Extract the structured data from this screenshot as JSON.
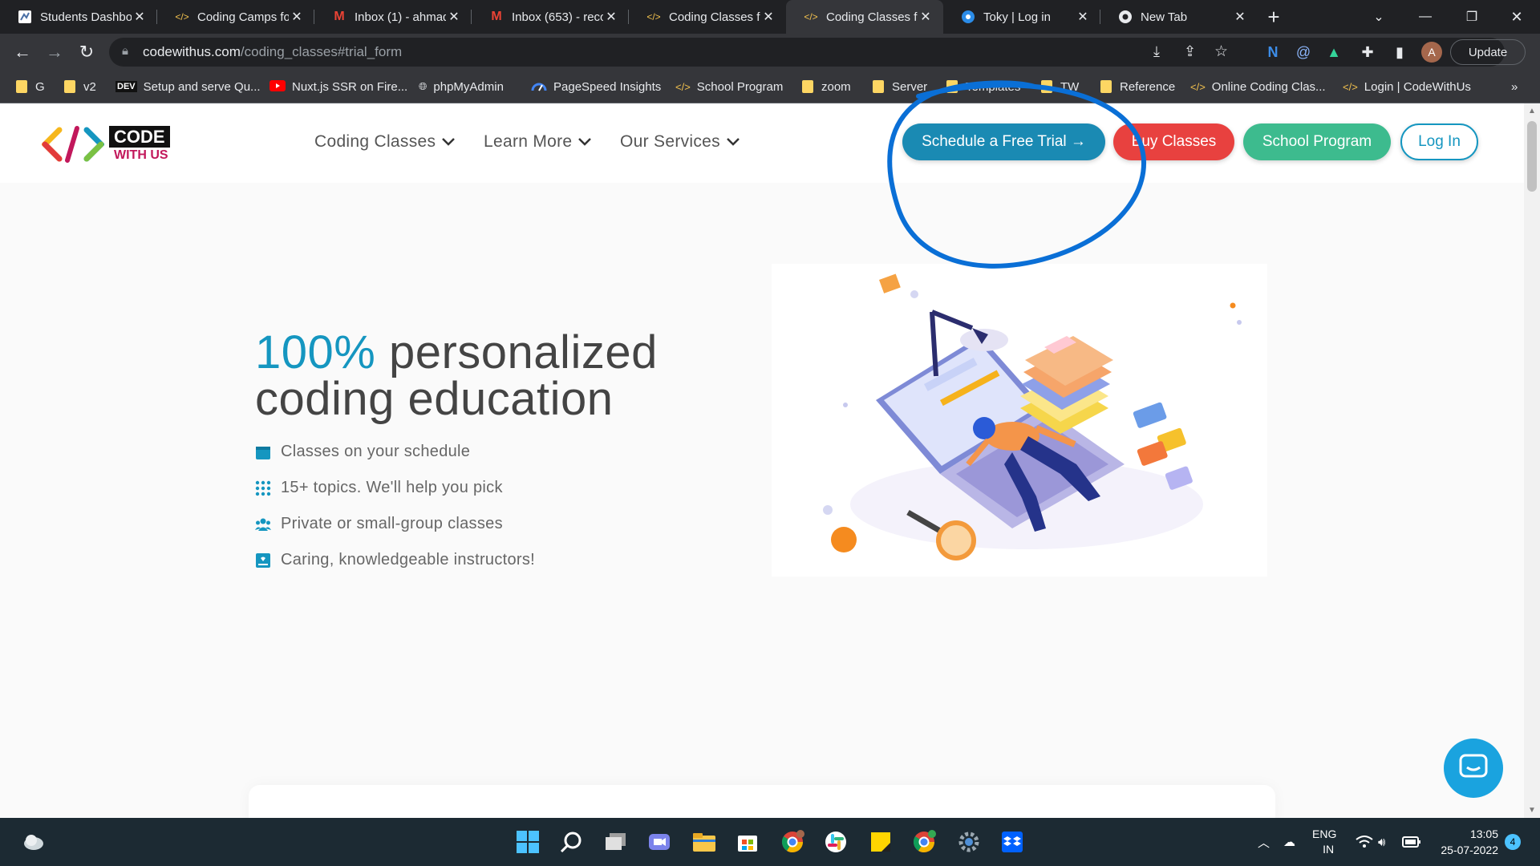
{
  "browser": {
    "tabs": [
      {
        "title": "Students Dashbo",
        "active": false
      },
      {
        "title": "Coding Camps fo",
        "active": false
      },
      {
        "title": "Inbox (1) - ahmad",
        "active": false
      },
      {
        "title": "Inbox (653) - reco",
        "active": false
      },
      {
        "title": "Coding Classes fo",
        "active": false
      },
      {
        "title": "Coding Classes fo",
        "active": true
      },
      {
        "title": "Toky | Log in",
        "active": false
      },
      {
        "title": "New Tab",
        "active": false
      }
    ],
    "url_host": "codewithus.com",
    "url_path": "/coding_classes#trial_form",
    "update_label": "Update",
    "profile_initial": "A",
    "bookmarks": [
      {
        "label": "G",
        "icon": "folder-icon"
      },
      {
        "label": "v2",
        "icon": "folder-icon"
      },
      {
        "label": "Setup and serve Qu...",
        "icon": "dev-icon",
        "badge": "DEV"
      },
      {
        "label": "Nuxt.js SSR on Fire...",
        "icon": "youtube-icon"
      },
      {
        "label": "phpMyAdmin",
        "icon": "globe-icon"
      },
      {
        "label": "PageSpeed Insights",
        "icon": "pagespeed-icon"
      },
      {
        "label": "School Program",
        "icon": "codewithus-icon"
      },
      {
        "label": "zoom",
        "icon": "folder-icon"
      },
      {
        "label": "Server",
        "icon": "folder-icon"
      },
      {
        "label": "Templates",
        "icon": "folder-icon"
      },
      {
        "label": "TW",
        "icon": "folder-icon"
      },
      {
        "label": "Reference",
        "icon": "folder-icon"
      },
      {
        "label": "Online Coding Clas...",
        "icon": "codewithus-icon"
      },
      {
        "label": "Login | CodeWithUs",
        "icon": "codewithus-icon"
      }
    ],
    "more_bookmarks": "»"
  },
  "site": {
    "logo": {
      "line1": "CODE",
      "line2": "WITH US"
    },
    "nav": [
      {
        "label": "Coding Classes"
      },
      {
        "label": "Learn More"
      },
      {
        "label": "Our Services"
      }
    ],
    "buttons": {
      "trial": "Schedule a Free Trial →",
      "buy": "Buy Classes",
      "school": "School Program",
      "login": "Log In"
    },
    "hero": {
      "title_accent": "100%",
      "title_rest": " personalized",
      "title_line2": "coding education"
    },
    "features": [
      {
        "label": "Classes on your schedule",
        "icon": "calendar-icon"
      },
      {
        "label": "15+ topics. We'll help you pick",
        "icon": "grid-dots-icon"
      },
      {
        "label": "Private or small-group classes",
        "icon": "people-icon"
      },
      {
        "label": "Caring, knowledgeable instructors!",
        "icon": "id-card-icon"
      }
    ],
    "colors": {
      "accent": "#1596c0",
      "trial": "#1a8ab3",
      "buy": "#e8413f",
      "school": "#3dbb8e",
      "login_border": "#1596c0",
      "annotation": "#0a6fd6"
    }
  },
  "taskbar": {
    "lang_line1": "ENG",
    "lang_line2": "IN",
    "time": "13:05",
    "date": "25-07-2022",
    "notifications": "4"
  }
}
